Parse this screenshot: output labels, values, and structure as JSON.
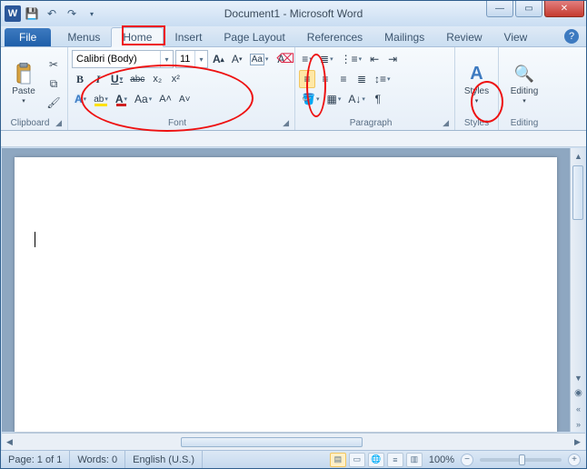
{
  "title": "Document1 - Microsoft Word",
  "appicon_letter": "W",
  "tabs": {
    "file": "File",
    "menus": "Menus",
    "home": "Home",
    "insert": "Insert",
    "page_layout": "Page Layout",
    "references": "References",
    "mailings": "Mailings",
    "review": "Review",
    "view": "View"
  },
  "ribbon": {
    "clipboard": {
      "label": "Clipboard",
      "paste": "Paste"
    },
    "font": {
      "label": "Font",
      "font_name": "Calibri (Body)",
      "font_size": "11",
      "bold": "B",
      "italic": "I",
      "underline": "U",
      "strike": "abc",
      "subscript": "x₂",
      "superscript": "x²",
      "highlight_label": "ab",
      "change_case": "Aa",
      "grow": "A˄",
      "shrink": "A˅",
      "clear": "A̸",
      "texteffects": "A"
    },
    "paragraph": {
      "label": "Paragraph",
      "show_marks": "¶"
    },
    "styles": {
      "label": "Styles",
      "button": "Styles"
    },
    "editing": {
      "label": "Editing",
      "button": "Editing"
    }
  },
  "status": {
    "page": "Page: 1 of 1",
    "words": "Words: 0",
    "language": "English (U.S.)",
    "zoom": "100%"
  }
}
